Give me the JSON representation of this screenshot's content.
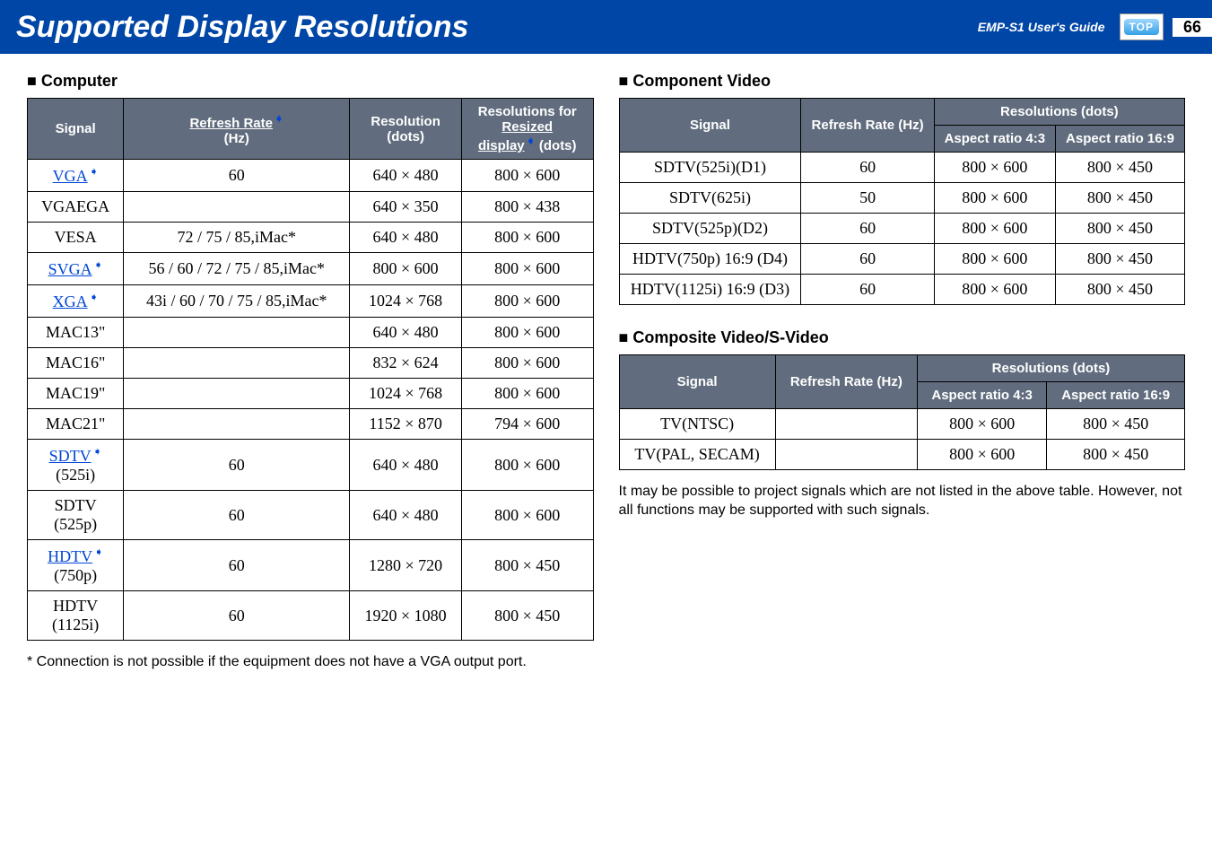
{
  "header": {
    "title": "Supported Display Resolutions",
    "guide": "EMP-S1 User's Guide",
    "top_label": "TOP",
    "page": "66"
  },
  "sections": {
    "computer": "■ Computer",
    "component": "■ Component Video",
    "composite": "■ Composite Video/S-Video"
  },
  "computer_table": {
    "headers": {
      "signal": "Signal",
      "refresh": "Refresh Rate",
      "refresh_unit": "(Hz)",
      "resolution": "Resolution",
      "resolution_unit": "(dots)",
      "resized": "Resolutions for",
      "resized2": "Resized",
      "resized3": "display",
      "resized4": " (dots)"
    },
    "rows": [
      {
        "signal": "VGA",
        "glossary": true,
        "refresh": "60",
        "res": "640 × 480",
        "resized": "800 × 600"
      },
      {
        "signal": "VGAEGA",
        "glossary": false,
        "refresh": "",
        "res": "640 × 350",
        "resized": "800 × 438"
      },
      {
        "signal": "VESA",
        "glossary": false,
        "refresh": "72 / 75 / 85,iMac*",
        "res": "640 × 480",
        "resized": "800 × 600"
      },
      {
        "signal": "SVGA",
        "glossary": true,
        "refresh": "56 / 60 / 72 / 75 / 85,iMac*",
        "res": "800 × 600",
        "resized": "800 × 600"
      },
      {
        "signal": "XGA",
        "glossary": true,
        "refresh": "43i / 60 / 70 / 75 / 85,iMac*",
        "res": "1024 × 768",
        "resized": "800 × 600"
      },
      {
        "signal": "MAC13\"",
        "glossary": false,
        "refresh": "",
        "res": "640 × 480",
        "resized": "800 × 600"
      },
      {
        "signal": "MAC16\"",
        "glossary": false,
        "refresh": "",
        "res": "832 × 624",
        "resized": "800 × 600"
      },
      {
        "signal": "MAC19\"",
        "glossary": false,
        "refresh": "",
        "res": "1024 × 768",
        "resized": "800 × 600"
      },
      {
        "signal": "MAC21\"",
        "glossary": false,
        "refresh": "",
        "res": "1152 × 870",
        "resized": "794 × 600"
      },
      {
        "signal": "SDTV",
        "signal2": "(525i)",
        "glossary": true,
        "refresh": "60",
        "res": "640 × 480",
        "resized": "800 × 600"
      },
      {
        "signal": "SDTV",
        "signal2": "(525p)",
        "glossary": false,
        "refresh": "60",
        "res": "640 × 480",
        "resized": "800 × 600"
      },
      {
        "signal": "HDTV",
        "signal2": "(750p)",
        "glossary": true,
        "refresh": "60",
        "res": "1280 × 720",
        "resized": "800 × 450"
      },
      {
        "signal": "HDTV",
        "signal2": "(1125i)",
        "glossary": false,
        "refresh": "60",
        "res": "1920 × 1080",
        "resized": "800 × 450"
      }
    ]
  },
  "computer_footnote": "* Connection is not possible if the equipment does not have a VGA output port.",
  "component_table": {
    "headers": {
      "signal": "Signal",
      "refresh": "Refresh Rate (Hz)",
      "res_header": "Resolutions (dots)",
      "a43": "Aspect ratio 4:3",
      "a169": "Aspect ratio 16:9"
    },
    "rows": [
      {
        "signal": "SDTV(525i)(D1)",
        "refresh": "60",
        "a43": "800 × 600",
        "a169": "800 × 450"
      },
      {
        "signal": "SDTV(625i)",
        "refresh": "50",
        "a43": "800 × 600",
        "a169": "800 × 450"
      },
      {
        "signal": "SDTV(525p)(D2)",
        "refresh": "60",
        "a43": "800 × 600",
        "a169": "800 × 450"
      },
      {
        "signal": "HDTV(750p) 16:9 (D4)",
        "refresh": "60",
        "a43": "800 × 600",
        "a169": "800 × 450"
      },
      {
        "signal": "HDTV(1125i) 16:9 (D3)",
        "refresh": "60",
        "a43": "800 × 600",
        "a169": "800 × 450"
      }
    ]
  },
  "composite_table": {
    "headers": {
      "signal": "Signal",
      "refresh": "Refresh Rate (Hz)",
      "res_header": "Resolutions (dots)",
      "a43": "Aspect ratio 4:3",
      "a169": "Aspect ratio 16:9"
    },
    "rows": [
      {
        "signal": "TV(NTSC)",
        "refresh": "",
        "a43": "800 × 600",
        "a169": "800 × 450"
      },
      {
        "signal": "TV(PAL, SECAM)",
        "refresh": "",
        "a43": "800 × 600",
        "a169": "800 × 450"
      }
    ]
  },
  "bottom_note": "It may be possible to project signals which are not listed in the above table. However, not all functions may be supported with such signals."
}
